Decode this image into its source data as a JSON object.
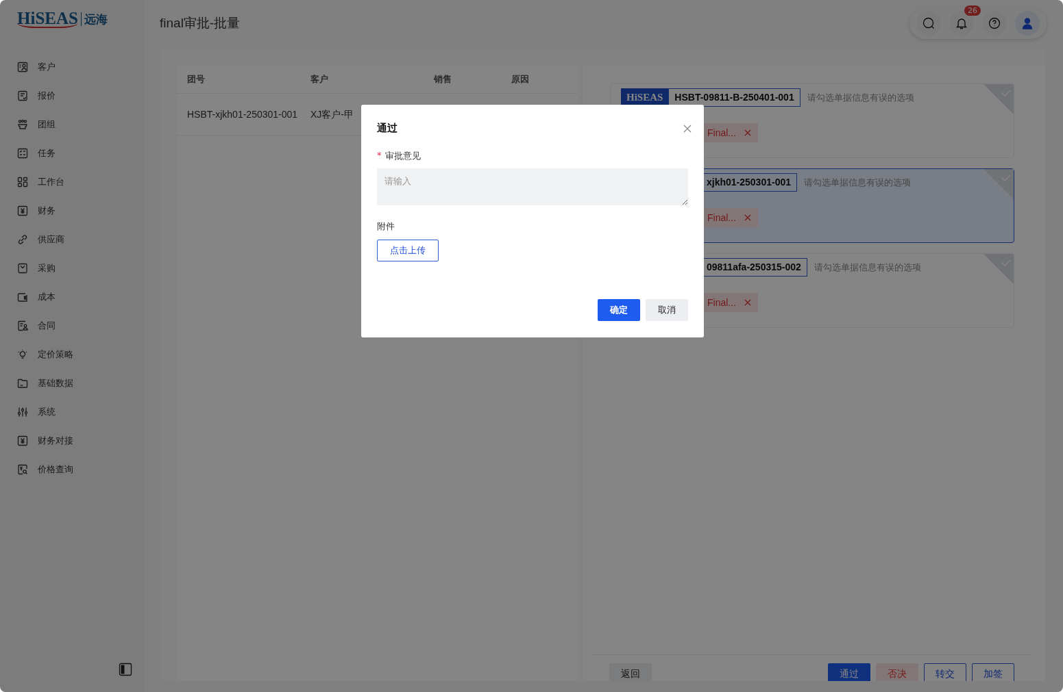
{
  "app": {
    "logo": "HiSEAS",
    "logo_cn": "远海"
  },
  "sidebar": {
    "items": [
      {
        "label": "客户"
      },
      {
        "label": "报价"
      },
      {
        "label": "团组"
      },
      {
        "label": "任务"
      },
      {
        "label": "工作台"
      },
      {
        "label": "财务"
      },
      {
        "label": "供应商"
      },
      {
        "label": "采购"
      },
      {
        "label": "成本"
      },
      {
        "label": "合同"
      },
      {
        "label": "定价策略"
      },
      {
        "label": "基础数据"
      },
      {
        "label": "系统"
      },
      {
        "label": "财务对接"
      },
      {
        "label": "价格查询"
      }
    ]
  },
  "header": {
    "title": "final审批-批量",
    "notification_count": "26"
  },
  "table": {
    "columns": [
      "团号",
      "客户",
      "销售",
      "原因"
    ],
    "rows": [
      {
        "cells": [
          "HSBT-xjkh01-250301-001",
          "XJ客户-甲"
        ]
      }
    ]
  },
  "cards": [
    {
      "logo": "HiSEAS",
      "code": "HSBT-09811-B-250401-001",
      "hint": "请勾选单据信息有误的选项",
      "tag": "Final...",
      "selected": false
    },
    {
      "code": "xjkh01-250301-001",
      "hint": "请勾选单据信息有误的选项",
      "tag": "Final...",
      "selected": true
    },
    {
      "code": "09811afa-250315-002",
      "hint": "请勾选单据信息有误的选项",
      "tag": "Final...",
      "selected": false
    }
  ],
  "actions": [
    {
      "label": "返回",
      "kind": "default"
    },
    {
      "label": "通过",
      "kind": "primary"
    },
    {
      "label": "否决",
      "kind": "danger"
    },
    {
      "label": "转交",
      "kind": "outline"
    },
    {
      "label": "加签",
      "kind": "outline"
    }
  ],
  "modal": {
    "title": "通过",
    "fields": [
      {
        "label": "审批意见",
        "required_mark": "*",
        "placeholder": "请输入"
      }
    ],
    "attachment_label": "附件",
    "upload_button": "点击上传",
    "buttons": [
      {
        "label": "确定",
        "kind": "primary"
      },
      {
        "label": "取消",
        "kind": "default"
      }
    ]
  }
}
